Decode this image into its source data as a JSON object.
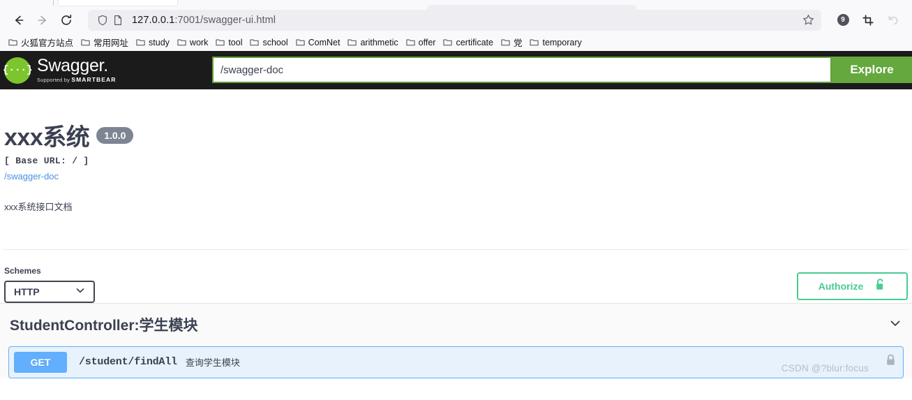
{
  "browser": {
    "back_label": "Back",
    "forward_label": "Forward",
    "reload_label": "Reload",
    "url_host": "127.0.0.1",
    "url_rest": ":7001/swagger-ui.html",
    "url_full": "127.0.0.1:7001/swagger-ui.html",
    "shield_icon": "shield-icon",
    "page_icon": "page-icon",
    "star_icon": "star-icon",
    "extension_badge_count": "9",
    "screenshot_icon": "crop-icon",
    "sync_icon": "undo-icon",
    "bookmarks": [
      {
        "label": "火狐官方站点"
      },
      {
        "label": "常用网址"
      },
      {
        "label": "study"
      },
      {
        "label": "work"
      },
      {
        "label": "tool"
      },
      {
        "label": "school"
      },
      {
        "label": "ComNet"
      },
      {
        "label": "arithmetic"
      },
      {
        "label": "offer"
      },
      {
        "label": "certificate"
      },
      {
        "label": "党"
      },
      {
        "label": "temporary"
      }
    ]
  },
  "topbar": {
    "logo_glyph": "{···}",
    "logo_title": "Swagger",
    "logo_dot": ".",
    "logo_supported_by": "Supported by",
    "logo_brand": "SMARTBEAR",
    "url_value": "/swagger-doc",
    "url_placeholder": "/swagger-doc",
    "explore_label": "Explore",
    "accent_green": "#64a83e"
  },
  "info": {
    "title": "xxx系统",
    "version": "1.0.0",
    "base_url": "[ Base URL: / ]",
    "doc_link": "/swagger-doc",
    "description": "xxx系统接口文档"
  },
  "schemes": {
    "label": "Schemes",
    "selected": "HTTP",
    "options": [
      "HTTP"
    ],
    "chevron_icon": "chevron-down-icon"
  },
  "authorize": {
    "label": "Authorize",
    "lock_icon": "unlock-icon",
    "accent": "#49cc90"
  },
  "tag": {
    "title": "StudentController:学生模块",
    "chevron_icon": "chevron-down-icon"
  },
  "operations": [
    {
      "method": "GET",
      "path": "/student/findAll",
      "summary": "查询学生模块",
      "lock_icon": "lock-icon",
      "color": "#61affe"
    }
  ],
  "watermark": "CSDN @?blur:focus"
}
